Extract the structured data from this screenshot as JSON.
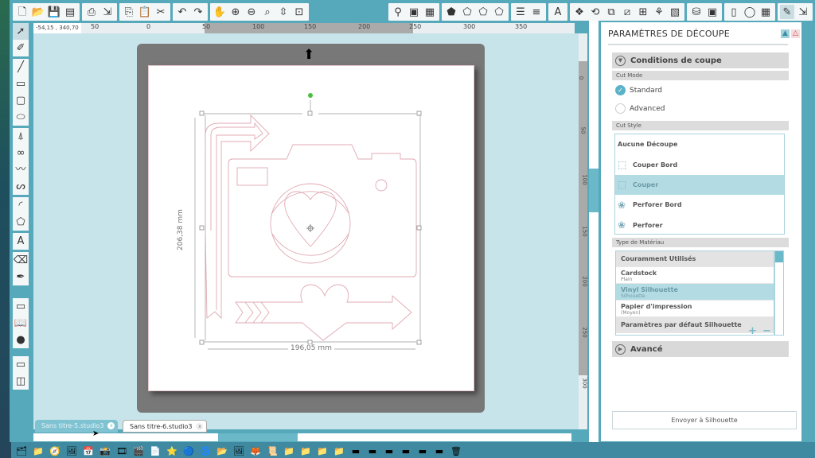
{
  "toolbar": {
    "groups": [
      [
        {
          "name": "new-document-icon",
          "g": "🗋"
        },
        {
          "name": "open-icon",
          "g": "📂"
        },
        {
          "name": "save-icon",
          "g": "💾"
        },
        {
          "name": "save-library-icon",
          "g": "▤"
        }
      ],
      [
        {
          "name": "print-icon",
          "g": "⎙"
        },
        {
          "name": "send-to-cutter-icon",
          "g": "⇲"
        }
      ],
      [
        {
          "name": "copy-icon",
          "g": "⎘"
        },
        {
          "name": "paste-icon",
          "g": "📋"
        },
        {
          "name": "cut-icon",
          "g": "✂"
        }
      ],
      [
        {
          "name": "undo-icon",
          "g": "↶"
        },
        {
          "name": "redo-icon",
          "g": "↷"
        }
      ],
      [
        {
          "name": "pan-hand-icon",
          "g": "✋"
        },
        {
          "name": "zoom-in-icon",
          "g": "⊕"
        },
        {
          "name": "zoom-out-icon",
          "g": "⊖"
        },
        {
          "name": "zoom-select-icon",
          "g": "⌕"
        },
        {
          "name": "drag-zoom-icon",
          "g": "⇳"
        },
        {
          "name": "fit-to-window-icon",
          "g": "⊡"
        }
      ]
    ],
    "right_groups": [
      [
        {
          "name": "fill-color-icon",
          "g": "⚲"
        },
        {
          "name": "gradient-icon",
          "g": "▣"
        },
        {
          "name": "fill-pattern-icon",
          "g": "▦"
        }
      ],
      [
        {
          "name": "line-color-icon",
          "g": "⬟"
        },
        {
          "name": "line-style-icon",
          "g": "⬠"
        },
        {
          "name": "shadow-icon",
          "g": "⬠"
        },
        {
          "name": "sketch-icon",
          "g": "⬠"
        }
      ],
      [
        {
          "name": "cut-settings-lines-icon",
          "g": "☰"
        },
        {
          "name": "offset-lines-icon",
          "g": "≡"
        }
      ],
      [
        {
          "name": "text-style-icon",
          "g": "A"
        }
      ],
      [
        {
          "name": "replicate-icon",
          "g": "❖"
        },
        {
          "name": "rotate-icon",
          "g": "⟲"
        },
        {
          "name": "scale-icon",
          "g": "⧉"
        },
        {
          "name": "shear-icon",
          "g": "⧄"
        },
        {
          "name": "align-icon",
          "g": "⊞"
        },
        {
          "name": "modify-icon",
          "g": "⚘"
        },
        {
          "name": "trace-icon",
          "g": "▧"
        }
      ],
      [
        {
          "name": "store-icon",
          "g": "⛁"
        },
        {
          "name": "library-icon",
          "g": "▣"
        }
      ],
      [
        {
          "name": "page-settings-icon",
          "g": "▯"
        },
        {
          "name": "registration-marks-icon",
          "g": "◯"
        },
        {
          "name": "grid-icon",
          "g": "▦"
        }
      ],
      [
        {
          "name": "cut-settings-icon",
          "g": "✎",
          "sel": true
        },
        {
          "name": "send-panel-icon",
          "g": "⇲"
        }
      ]
    ]
  },
  "left_tools": [
    [
      {
        "name": "select-tool-icon",
        "g": "➚",
        "sel": true
      },
      {
        "name": "edit-points-icon",
        "g": "✐"
      }
    ],
    [
      {
        "name": "line-tool-icon",
        "g": "╱"
      },
      {
        "name": "rectangle-tool-icon",
        "g": "▭"
      },
      {
        "name": "rounded-rectangle-tool-icon",
        "g": "▢"
      },
      {
        "name": "ellipse-tool-icon",
        "g": "⬭"
      }
    ],
    [
      {
        "name": "polygon-tool-icon",
        "g": "⍋"
      },
      {
        "name": "curve-tool-icon",
        "g": "∞"
      },
      {
        "name": "freehand-tool-icon",
        "g": "〰"
      },
      {
        "name": "smooth-freehand-tool-icon",
        "g": "ᔕ"
      }
    ],
    [
      {
        "name": "arc-tool-icon",
        "g": "◜"
      },
      {
        "name": "regular-polygon-tool-icon",
        "g": "⬠"
      }
    ],
    [
      {
        "name": "text-tool-icon",
        "g": "A"
      }
    ],
    [
      {
        "name": "eraser-tool-icon",
        "g": "⌫"
      },
      {
        "name": "knife-tool-icon",
        "g": "✒"
      }
    ],
    [
      {
        "name": "design-page-icon",
        "g": "▭"
      },
      {
        "name": "library-book-icon",
        "g": "📖"
      },
      {
        "name": "online-store-icon",
        "g": "●"
      }
    ],
    [
      {
        "name": "show-single-view-icon",
        "g": "▭"
      },
      {
        "name": "split-view-icon",
        "g": "◫"
      }
    ]
  ],
  "ruler": {
    "coords": "-54,15 , 340,70",
    "h_labels": [
      "50",
      "0",
      "50",
      "100",
      "150",
      "200",
      "250",
      "300",
      "350"
    ],
    "v_labels": [
      "0",
      "50",
      "100",
      "150",
      "200",
      "250",
      "300"
    ]
  },
  "design": {
    "height_label": "206,38 mm",
    "width_label": "196,05 mm"
  },
  "panel": {
    "title": "PARAMÈTRES DE DÉCOUPE",
    "conditions_label": "Conditions de coupe",
    "cut_mode_label": "Cut Mode",
    "modes": [
      {
        "label": "Standard",
        "selected": true
      },
      {
        "label": "Advanced",
        "selected": false
      }
    ],
    "cut_style_label": "Cut Style",
    "styles": [
      {
        "label": "Aucune Découpe",
        "icon": "",
        "name": "style-no-cut"
      },
      {
        "label": "Couper Bord",
        "icon": "⬚",
        "name": "style-cut-edge"
      },
      {
        "label": "Couper",
        "icon": "⬚",
        "name": "style-cut",
        "selected": true
      },
      {
        "label": "Perforer Bord",
        "icon": "❀",
        "name": "style-perforate-edge"
      },
      {
        "label": "Perforer",
        "icon": "❀",
        "name": "style-perforate"
      }
    ],
    "material_label": "Type de Matériau",
    "materials": [
      {
        "label": "Couramment Utilisés",
        "header": true
      },
      {
        "label": "Cardstock",
        "sub": "Plain"
      },
      {
        "label": "Vinyl Silhouette",
        "sub": "Silhouette",
        "selected": true
      },
      {
        "label": "Papier d'impression",
        "sub": "(Moyen)"
      },
      {
        "label": "Paramètres par défaut Silhouette",
        "header": true
      }
    ],
    "add_label": "+",
    "remove_label": "−",
    "advanced_label": "Avancé",
    "send_label": "Envoyer à Silhouette"
  },
  "tabs": [
    {
      "label": "Sans titre-5.studio3",
      "active": false
    },
    {
      "label": "Sans titre-6.studio3",
      "active": true
    }
  ],
  "dock": [
    "🗂",
    "📁",
    "🧭",
    "🖼",
    "📅",
    "📸",
    "🎞",
    "🎬",
    "📄",
    "⭐",
    "🔵",
    "🌀",
    "📂",
    "🖼",
    "🦊",
    "📜",
    "📁",
    "📁",
    "📁",
    "📁",
    "▬",
    "▬",
    "▬",
    "▬",
    "▬",
    "▬",
    "🗑"
  ]
}
